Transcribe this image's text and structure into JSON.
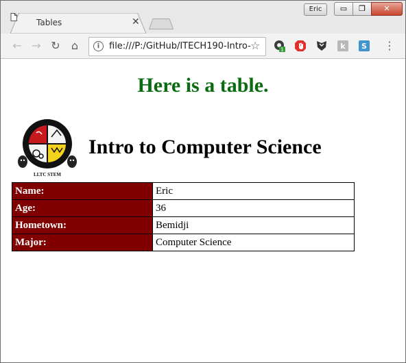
{
  "browser": {
    "tab_title": "Tables",
    "user_name": "Eric",
    "address": "file:///P:/GitHub/ITECH190-Intro-",
    "extension_badge": "1",
    "colors": {
      "tab_bar": "#e8e8e8",
      "toolbar": "#f2f2f2",
      "close_button": "#c7442c"
    }
  },
  "page": {
    "heading": "Here is a table.",
    "heading_color": "#0b6b11",
    "logo_caption": "LLTC STEM",
    "course_title": "Intro to Computer Science",
    "table": {
      "header_color": "#800000",
      "rows": [
        {
          "label": "Name:",
          "value": "Eric"
        },
        {
          "label": "Age:",
          "value": "36"
        },
        {
          "label": "Hometown:",
          "value": "Bemidji"
        },
        {
          "label": "Major:",
          "value": "Computer Science"
        }
      ]
    }
  }
}
